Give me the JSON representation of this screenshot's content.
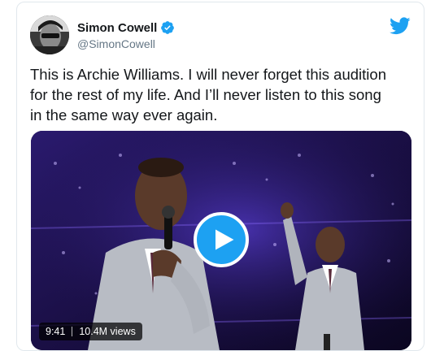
{
  "tweet": {
    "author_name": "Simon Cowell",
    "author_handle": "@SimonCowell",
    "verified": true,
    "text": "This is Archie Williams. I will never forget this audition\nfor the rest of my life. And I’ll never listen to this song\nin the same way ever again."
  },
  "media": {
    "type": "video",
    "duration": "9:41",
    "views": "10.4M views"
  },
  "icons": {
    "brand": "twitter-bird-icon",
    "verified": "verified-badge-icon",
    "play": "play-icon"
  },
  "colors": {
    "brand_blue": "#1da1f2",
    "text_primary": "#14171a",
    "text_secondary": "#657786",
    "border": "#e1e8ed"
  }
}
